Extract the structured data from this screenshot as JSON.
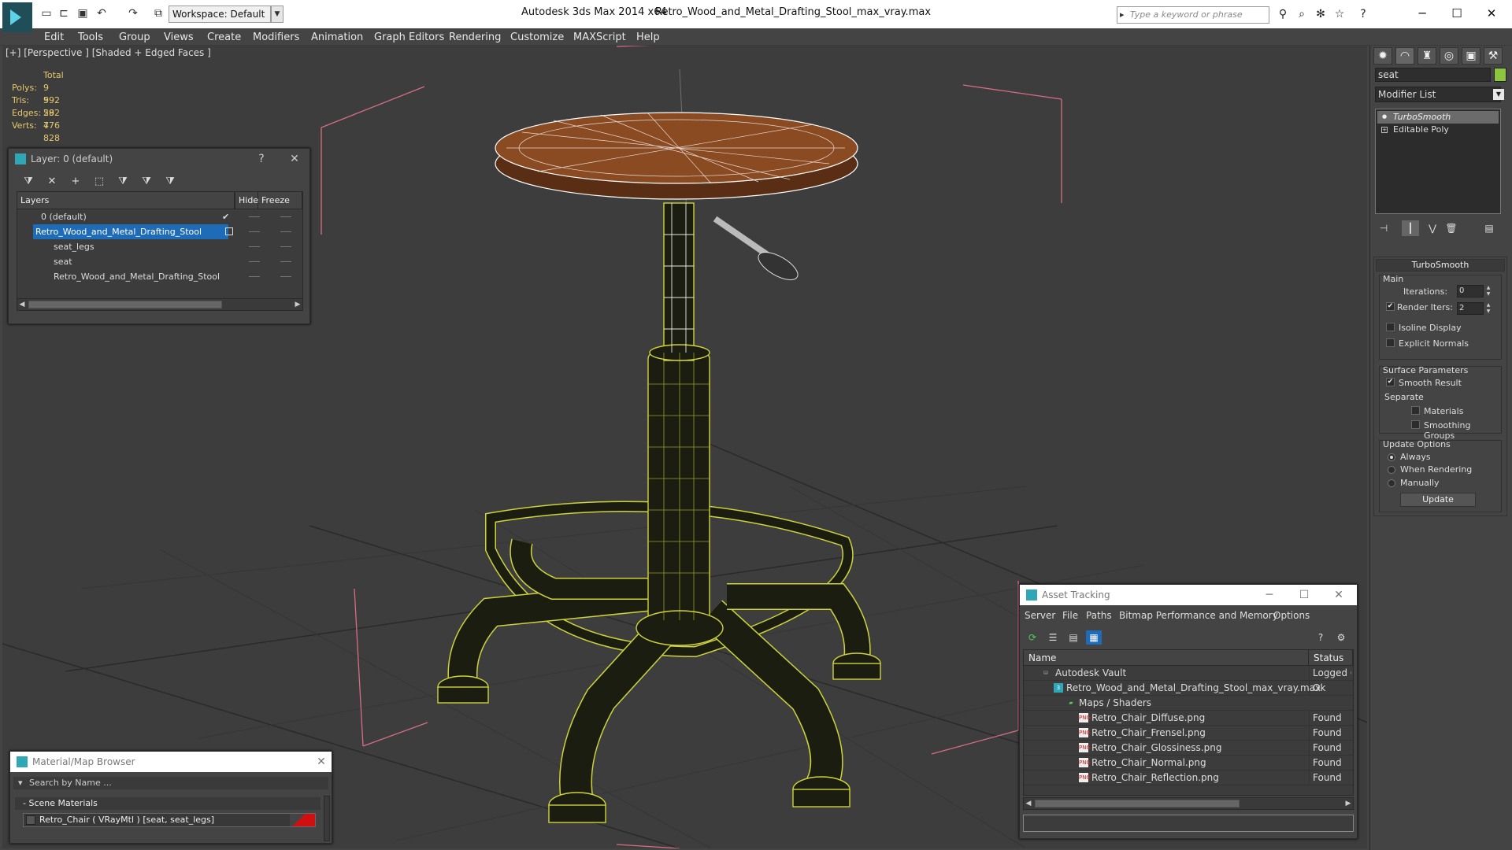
{
  "titlebar": {
    "app_title": "Autodesk 3ds Max  2014 x64",
    "file_title": "Retro_Wood_and_Metal_Drafting_Stool_max_vray.max",
    "workspace": "Workspace: Default",
    "search_placeholder": "Type a keyword or phrase"
  },
  "menu": [
    "Edit",
    "Tools",
    "Group",
    "Views",
    "Create",
    "Modifiers",
    "Animation",
    "Graph Editors",
    "Rendering",
    "Customize",
    "MAXScript",
    "Help"
  ],
  "viewport": {
    "label": "[+] [Perspective ] [Shaded + Edged Faces ]",
    "stats": {
      "total_label": "Total",
      "rows": [
        {
          "label": "Polys:",
          "value": "9 592"
        },
        {
          "label": "Tris:",
          "value": "9 592"
        },
        {
          "label": "Edges:",
          "value": "28 776"
        },
        {
          "label": "Verts:",
          "value": "4 828"
        }
      ]
    }
  },
  "layer_panel": {
    "title": "Layer: 0 (default)",
    "help": "?",
    "columns": {
      "layers": "Layers",
      "hide": "Hide",
      "freeze": "Freeze"
    },
    "rows": [
      {
        "name": "0 (default)",
        "indent": 1,
        "selected": false,
        "check": "✔"
      },
      {
        "name": "Retro_Wood_and_Metal_Drafting_Stool",
        "indent": 1,
        "selected": true,
        "check": ""
      },
      {
        "name": "seat_legs",
        "indent": 2,
        "selected": false,
        "check": ""
      },
      {
        "name": "seat",
        "indent": 2,
        "selected": false,
        "check": ""
      },
      {
        "name": "Retro_Wood_and_Metal_Drafting_Stool",
        "indent": 2,
        "selected": false,
        "check": ""
      }
    ]
  },
  "command_panel": {
    "object_name": "seat",
    "object_color": "#8cc63f",
    "modifier_list": "Modifier List",
    "stack": [
      {
        "name": "TurboSmooth",
        "selected": true
      },
      {
        "name": "Editable Poly",
        "selected": false
      }
    ],
    "turbosmooth": {
      "title": "TurboSmooth",
      "main": "Main",
      "iterations_label": "Iterations:",
      "iterations_value": "0",
      "render_iters_label": "Render Iters:",
      "render_iters_value": "2",
      "isoline": "Isoline Display",
      "explicit_normals": "Explicit Normals",
      "surface_params": "Surface Parameters",
      "smooth_result": "Smooth Result",
      "separate": "Separate",
      "materials": "Materials",
      "smoothing_groups": "Smoothing Groups",
      "update_options": "Update Options",
      "always": "Always",
      "when_rendering": "When Rendering",
      "manually": "Manually",
      "update": "Update"
    }
  },
  "asset_tracking": {
    "title": "Asset Tracking",
    "menu": [
      "Server",
      "File",
      "Paths",
      "Bitmap Performance and Memory",
      "Options"
    ],
    "columns": {
      "name": "Name",
      "status": "Status"
    },
    "rows": [
      {
        "name": "Autodesk Vault",
        "status": "Logged Out",
        "indent": 1,
        "icon": "vault"
      },
      {
        "name": "Retro_Wood_and_Metal_Drafting_Stool_max_vray.max",
        "status": "Ok",
        "indent": 2,
        "icon": "max"
      },
      {
        "name": "Maps / Shaders",
        "status": "",
        "indent": 3,
        "icon": "maps"
      },
      {
        "name": "Retro_Chair_Diffuse.png",
        "status": "Found",
        "indent": 4,
        "icon": "png"
      },
      {
        "name": "Retro_Chair_Frensel.png",
        "status": "Found",
        "indent": 4,
        "icon": "png"
      },
      {
        "name": "Retro_Chair_Glossiness.png",
        "status": "Found",
        "indent": 4,
        "icon": "png"
      },
      {
        "name": "Retro_Chair_Normal.png",
        "status": "Found",
        "indent": 4,
        "icon": "png"
      },
      {
        "name": "Retro_Chair_Reflection.png",
        "status": "Found",
        "indent": 4,
        "icon": "png"
      }
    ]
  },
  "material_browser": {
    "title": "Material/Map Browser",
    "search_placeholder": "Search by Name ...",
    "category": "- Scene Materials",
    "item": "Retro_Chair  ( VRayMtl )  [seat, seat_legs]"
  }
}
